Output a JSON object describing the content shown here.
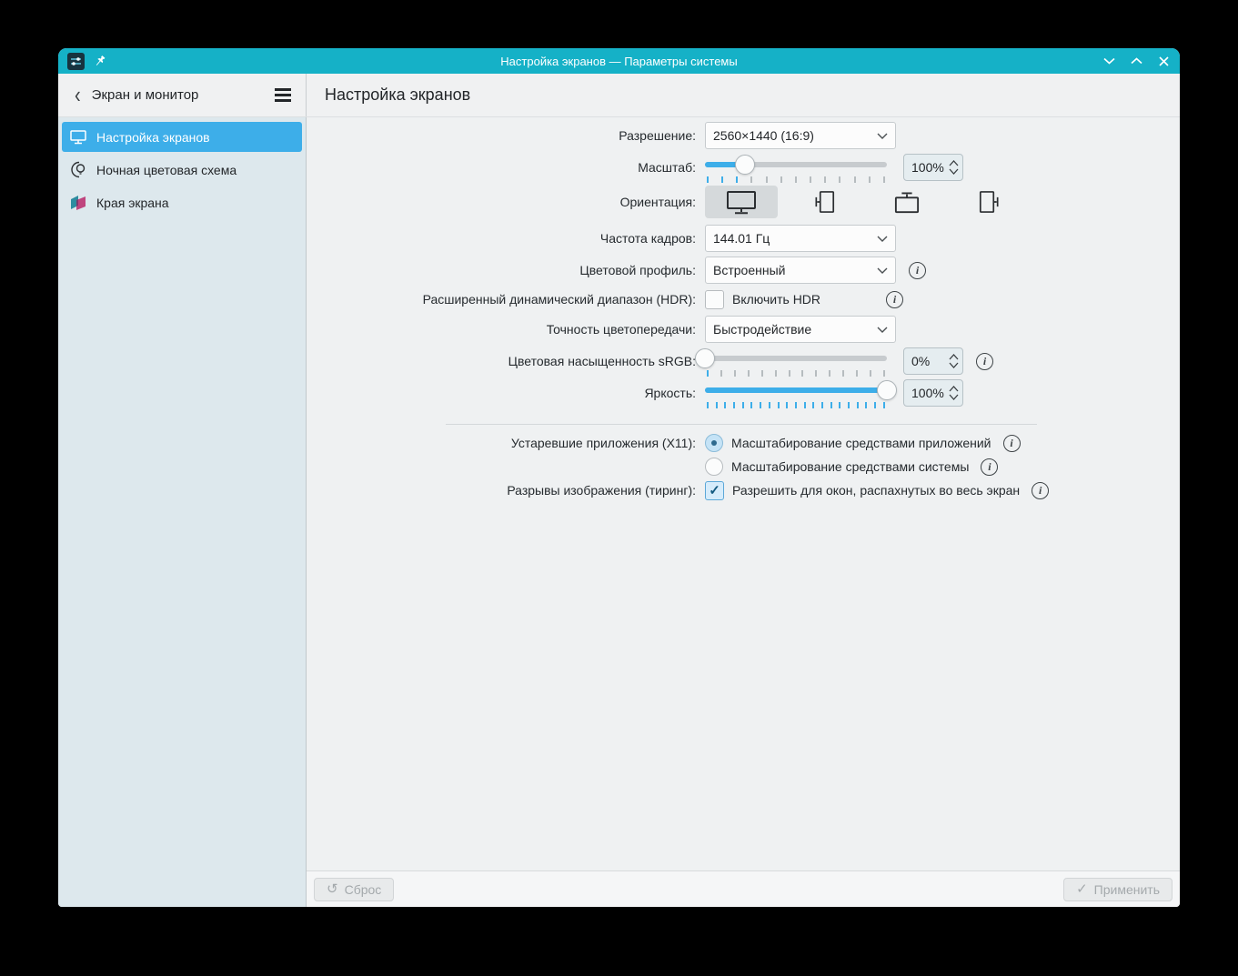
{
  "window": {
    "title": "Настройка экранов — Параметры системы"
  },
  "header": {
    "back_label": "Экран и монитор",
    "page_title": "Настройка экранов"
  },
  "sidebar": {
    "items": [
      {
        "label": "Настройка экранов",
        "icon": "monitor-icon",
        "selected": true
      },
      {
        "label": "Ночная цветовая схема",
        "icon": "night-color-icon",
        "selected": false
      },
      {
        "label": "Края экрана",
        "icon": "screen-edges-icon",
        "selected": false
      }
    ]
  },
  "form": {
    "resolution": {
      "label": "Разрешение:",
      "value": "2560×1440 (16:9)"
    },
    "scale": {
      "label": "Масштаб:",
      "value": "100%",
      "slider": {
        "percent": 22,
        "ticks": 13,
        "active_ticks": 3
      }
    },
    "orientation": {
      "label": "Ориентация:",
      "options": [
        "landscape",
        "portrait-left",
        "landscape-flipped",
        "portrait-right"
      ],
      "selected_index": 0
    },
    "refresh_rate": {
      "label": "Частота кадров:",
      "value": "144.01 Гц"
    },
    "color_profile": {
      "label": "Цветовой профиль:",
      "value": "Встроенный"
    },
    "hdr": {
      "label": "Расширенный динамический диапазон (HDR):",
      "checkbox_label": "Включить HDR",
      "checked": false
    },
    "color_accuracy": {
      "label": "Точность цветопередачи:",
      "value": "Быстродействие"
    },
    "srgb_saturation": {
      "label": "Цветовая насыщенность sRGB:",
      "value": "0%",
      "slider": {
        "percent": 0,
        "ticks": 14,
        "active_ticks": 1
      }
    },
    "brightness": {
      "label": "Яркость:",
      "value": "100%",
      "slider": {
        "percent": 100,
        "ticks": 21,
        "active_ticks": 21
      }
    },
    "x11_legacy": {
      "label": "Устаревшие приложения (X11):",
      "options": [
        {
          "label": "Масштабирование средствами приложений",
          "selected": true
        },
        {
          "label": "Масштабирование средствами системы",
          "selected": false
        }
      ]
    },
    "tearing": {
      "label": "Разрывы изображения (тиринг):",
      "checkbox_label": "Разрешить для окон, распахнутых во весь экран",
      "checked": true
    }
  },
  "footer": {
    "reset_label": "Сброс",
    "apply_label": "Применить"
  },
  "colors": {
    "titlebar": "#15b1c7",
    "accent": "#3daee9",
    "sidebar_bg": "#dde8ed",
    "content_bg": "#eff1f2"
  }
}
